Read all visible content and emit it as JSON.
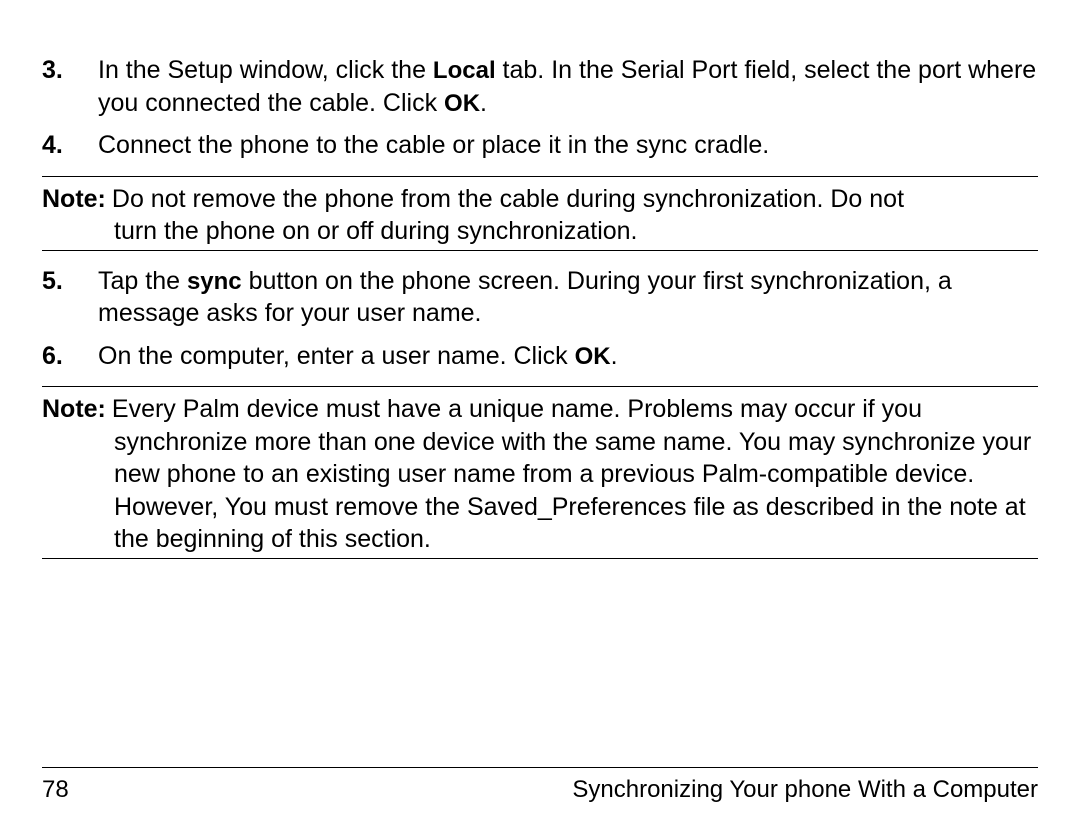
{
  "steps": {
    "s3": {
      "num": "3.",
      "pre": "In the Setup window, click the ",
      "term1": "Local",
      "mid": " tab. In the Serial Port field, select the port where you connected the cable. Click ",
      "term2": "OK",
      "post": "."
    },
    "s4": {
      "num": "4.",
      "text": "Connect the phone to the cable or place it in the sync cradle."
    },
    "s5": {
      "num": "5.",
      "pre": "Tap the ",
      "term1": "sync",
      "post": " button on the phone screen. During your first synchronization, a message asks for your user name."
    },
    "s6": {
      "num": "6.",
      "pre": "On the computer, enter a user name. Click ",
      "term1": "OK",
      "post": "."
    }
  },
  "notes": {
    "n1": {
      "label": "Note:",
      "first": "Do not remove the phone from the cable during synchronization. Do not",
      "rest": "turn the phone on or off during synchronization."
    },
    "n2": {
      "label": "Note:",
      "first": "Every Palm device must have a unique name. Problems may occur if you",
      "rest": "synchronize more than one device with the same name. You may synchronize your new phone to an existing user name from a previous Palm-compatible device. However, You must remove the Saved_Preferences file as described in the note at the beginning of this section."
    }
  },
  "footer": {
    "page_number": "78",
    "section_title": "Synchronizing Your phone With a Computer"
  }
}
